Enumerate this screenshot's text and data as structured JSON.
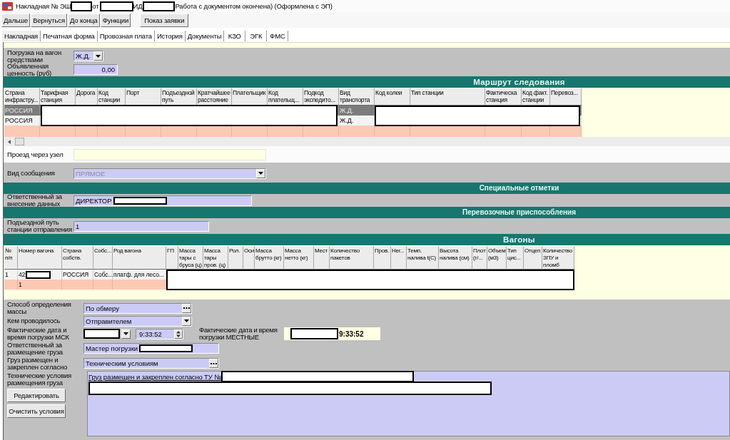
{
  "window": {
    "title_parts": [
      {
        "text": "Накладная № ЭШ",
        "redacted_after": true
      },
      {
        "text": "от",
        "redacted_after": true
      },
      {
        "text": "ИД",
        "redacted_after": true
      },
      {
        "text": "Работа с документом окончена) (Оформлена с ЭП)",
        "redacted_after": false
      }
    ]
  },
  "toolbar": {
    "groups": [
      [
        "Дальше",
        "Вернуться",
        "До конца",
        "Функции"
      ],
      [
        "Показ заявки"
      ]
    ]
  },
  "tabs": [
    {
      "label": "Накладная",
      "selected": true
    },
    {
      "label": "Печатная форма",
      "selected": false
    },
    {
      "label": "Провозная плата",
      "selected": false
    },
    {
      "label": "История",
      "selected": false
    },
    {
      "label": "Документы",
      "selected": false
    },
    {
      "label": "КЗО",
      "selected": false
    },
    {
      "label": "ЭГК",
      "selected": false
    },
    {
      "label": "ФМС",
      "selected": false
    }
  ],
  "loading": {
    "rows": [
      {
        "kind": "combo",
        "label": "Погрузка на вагон средствами",
        "value": "Ж.Д."
      },
      {
        "kind": "number",
        "label": "Объявленная ценность (руб)",
        "value": "0,00"
      }
    ]
  },
  "route": {
    "section": {
      "title": "Маршрут следования",
      "kind": "major"
    },
    "columns": [
      "Страна инфрастру...",
      "Тарифная станция",
      "Дорога",
      "Код станции",
      "Порт",
      "Подъездной путь",
      "Кратчайшее расстояние",
      "Плательщик",
      "Код плательщ...",
      "Подкод экспедито...",
      "Вид транспорта",
      "Код колеи",
      "Тип станции",
      "Фактическа станция",
      "Код факт. станции",
      "Перевоз..."
    ],
    "rows": [
      {
        "kind": "data",
        "selected": true,
        "country": "РОССИЯ",
        "transport": "Ж.Д."
      },
      {
        "kind": "data",
        "selected": false,
        "country": "РОССИЯ",
        "transport": "Ж.Д."
      },
      {
        "kind": "new",
        "selected": false
      }
    ]
  },
  "passage": {
    "label": "Проезд через узел"
  },
  "message_type": {
    "label": "Вид сообщения",
    "value": "ПРЯМОЕ",
    "disabled": true
  },
  "special_marks": {
    "section": {
      "title": "Специальные отметки",
      "kind": "minor"
    },
    "label": "Ответственный за внесение данных",
    "value": "ДИРЕКТОР",
    "redacted": true
  },
  "transport_devices": {
    "section": {
      "title": "Перевозочные приспособления",
      "kind": "minor"
    },
    "label": "Подъездной путь станции отправления",
    "value": "1"
  },
  "wagons": {
    "section": {
      "title": "Вагоны",
      "kind": "major"
    },
    "columns": [
      "№ п/п",
      "Номер вагона",
      "Страна собств.",
      "Собс...",
      "Род вагона",
      "ГП",
      "Масса тары с бруса (ц)",
      "Масса тары пров. (ц)",
      "Рол.",
      "Оси",
      "Масса брутто (кг)",
      "Масса нетто (кг)",
      "Мест",
      "Количество пакетов",
      "Пров.",
      "Нег...",
      "Темп. налива t(C)",
      "Высота налива (см)",
      "Плот (г/...",
      "Объем (м3)",
      "Тип цис...",
      "Отцеп",
      "Количество ЗПУ и пломб"
    ],
    "rows": [
      {
        "kind": "data",
        "selected": false,
        "index": "1",
        "number": "42",
        "number_redacted": true,
        "country": "РОССИЯ",
        "owner": "Собс...",
        "wagon_type": "платф. для лесо..."
      },
      {
        "kind": "new",
        "selected": false,
        "number": "1"
      }
    ]
  },
  "cargo": {
    "rows": [
      {
        "kind": "picker",
        "label": "Способ определения массы",
        "value": "По обмеру"
      },
      {
        "kind": "combo",
        "label": "Кем проводилось",
        "value": "Отправителем"
      },
      {
        "kind": "datetime",
        "label": "Фактические дата и время погрузки МСК",
        "date_redacted": true,
        "time": "9:33:52",
        "local": {
          "label": "Фактические дата и время погрузки МЕСТНЫЕ",
          "date_redacted": true,
          "time": "9:33:52"
        }
      },
      {
        "kind": "text",
        "label": "Ответственный за размещение груза",
        "value": "Мастер погрузки",
        "redacted": true
      },
      {
        "kind": "picker",
        "label": "Груз размещен и закреплен согласно",
        "value": "Техническим условиям"
      }
    ],
    "conditions": {
      "label": "Технические условия размещения груза",
      "text": "Груз размещен и закреплен согласно ТУ №",
      "redacted": true,
      "buttons": [
        "Редактировать",
        "Очистить условия"
      ]
    }
  }
}
